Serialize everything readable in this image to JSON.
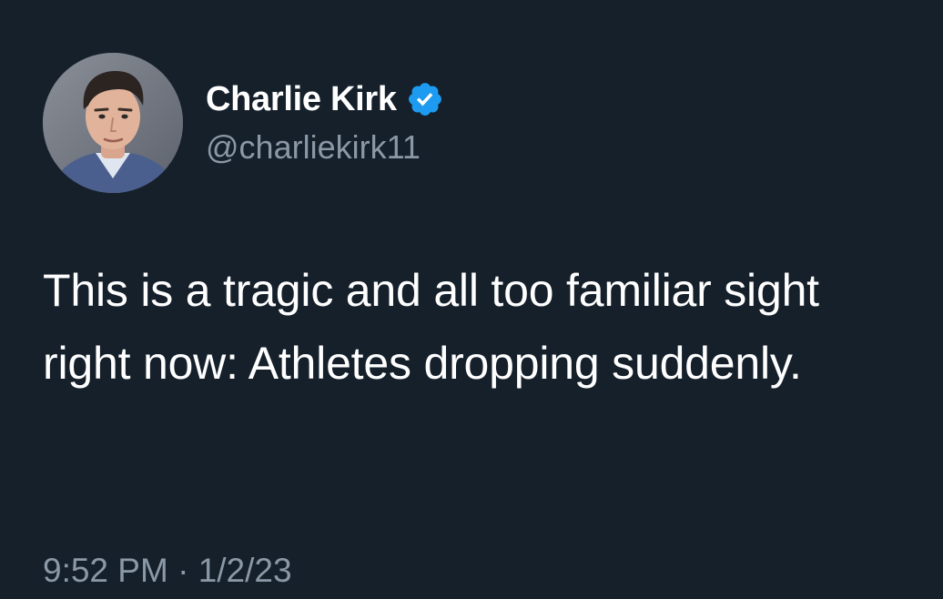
{
  "theme": {
    "background": "#15202b",
    "text_primary": "#ffffff",
    "text_secondary": "#8b98a5",
    "verified_badge": "#1d9bf0"
  },
  "author": {
    "display_name": "Charlie Kirk",
    "handle": "@charliekirk11",
    "verified": true,
    "verified_icon": "verified-badge-icon",
    "avatar": "profile-photo"
  },
  "tweet": {
    "text": "This is a tragic and all too familiar sight right now: Athletes dropping suddenly.",
    "time": "9:52 PM",
    "separator": "·",
    "date": "1/2/23"
  }
}
